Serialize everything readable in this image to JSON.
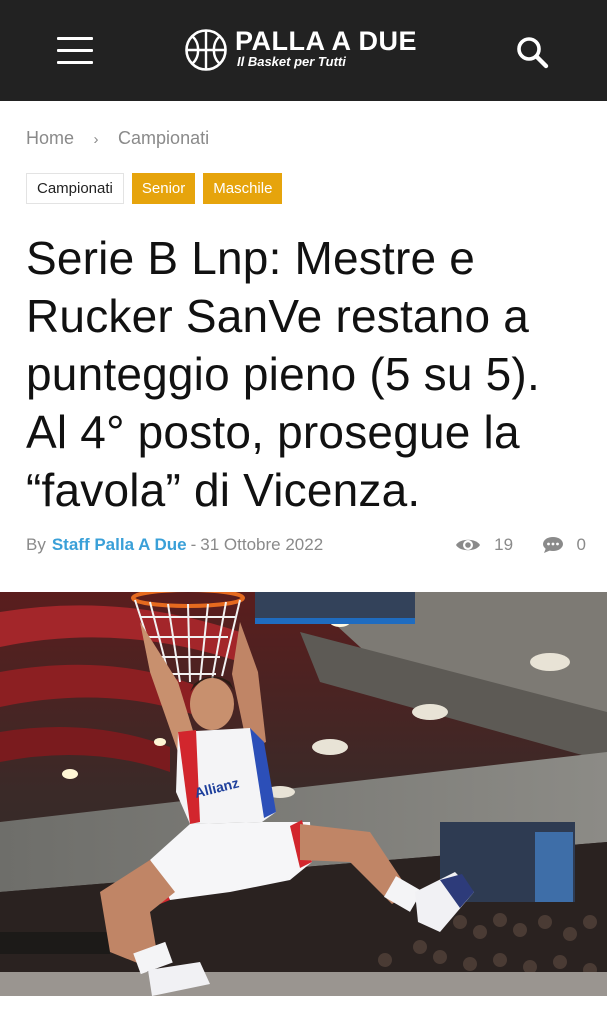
{
  "header": {
    "brand_name": "PALLA A DUE",
    "brand_tagline": "Il Basket per Tutti",
    "menu_icon": "hamburger-menu-icon",
    "search_icon": "search-icon",
    "background_color": "#222222"
  },
  "breadcrumb": {
    "items": [
      "Home",
      "Campionati"
    ]
  },
  "tags": [
    "Campionati",
    "Senior",
    "Maschile"
  ],
  "article": {
    "title": "Serie B Lnp: Mestre e Rucker SanVe restano a punteggio pieno (5 su 5). Al 4° posto, prosegue la “favola” di Vicenza.",
    "by_label": "By",
    "author": "Staff Palla A Due",
    "separator": "-",
    "date": "31 Ottobre 2022",
    "views": "19",
    "comments": "0",
    "views_icon": "eye-icon",
    "comments_icon": "comment-bubble-icon"
  },
  "hero": {
    "jersey_text": "Allianz"
  },
  "colors": {
    "accent_tag": "#e6a40c",
    "author_link": "#3aa0d8",
    "muted_text": "#8a8a8a"
  }
}
